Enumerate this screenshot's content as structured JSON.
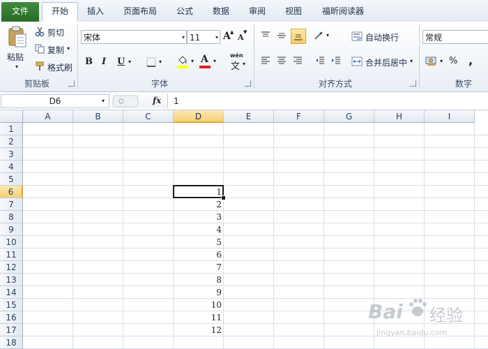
{
  "tabs": [
    "文件",
    "开始",
    "插入",
    "页面布局",
    "公式",
    "数据",
    "审阅",
    "视图",
    "福昕阅读器"
  ],
  "clipboard": {
    "paste": "粘贴",
    "cut": "剪切",
    "copy": "复制",
    "format_painter": "格式刷",
    "group_label": "剪贴板"
  },
  "font": {
    "name": "宋体",
    "size": "11",
    "bold": "B",
    "italic": "I",
    "underline": "U",
    "grow_icon": "A",
    "shrink_icon": "A",
    "fill_icon": "A",
    "font_color_icon": "A",
    "phonetic_top": "wén",
    "phonetic_char": "文",
    "group_label": "字体",
    "fill_color": "#ffff00",
    "font_color": "#e02020"
  },
  "alignment": {
    "wrap_text": "自动换行",
    "merge_center": "合并后居中",
    "group_label": "对齐方式"
  },
  "number": {
    "format": "常规",
    "percent": "%",
    "comma": ",",
    "group_label": "数字"
  },
  "formula_bar": {
    "name_box": "D6",
    "fx_label": "fx",
    "content": "1"
  },
  "grid": {
    "columns": [
      "A",
      "B",
      "C",
      "D",
      "E",
      "F",
      "G",
      "H",
      "I"
    ],
    "selected_column": "D",
    "rows": [
      "1",
      "2",
      "3",
      "4",
      "5",
      "6",
      "7",
      "8",
      "9",
      "10",
      "11",
      "12",
      "13",
      "14",
      "15",
      "16",
      "17",
      "18"
    ],
    "selected_row": "6",
    "active_cell": "D6",
    "d_values": [
      {
        "row": 6,
        "value": "1"
      },
      {
        "row": 7,
        "value": "2"
      },
      {
        "row": 8,
        "value": "3"
      },
      {
        "row": 9,
        "value": "4"
      },
      {
        "row": 10,
        "value": "5"
      },
      {
        "row": 11,
        "value": "6"
      },
      {
        "row": 12,
        "value": "7"
      },
      {
        "row": 13,
        "value": "8"
      },
      {
        "row": 14,
        "value": "9"
      },
      {
        "row": 15,
        "value": "10"
      },
      {
        "row": 16,
        "value": "11"
      },
      {
        "row": 17,
        "value": "12"
      }
    ]
  },
  "watermark": {
    "brand": "Bai",
    "brand_cn": "经验",
    "url": "jingyan.baidu.com"
  }
}
